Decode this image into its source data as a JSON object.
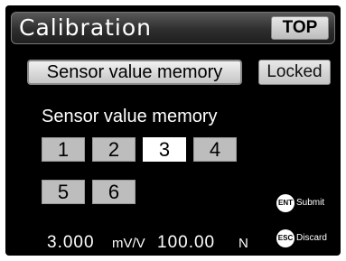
{
  "header": {
    "title": "Calibration",
    "top_button": "TOP"
  },
  "menu": {
    "selected_item": "Sensor value memory",
    "status": "Locked"
  },
  "memory": {
    "label": "Sensor value memory",
    "slots": [
      "1",
      "2",
      "3",
      "4",
      "5",
      "6"
    ],
    "selected": "3"
  },
  "keys": {
    "submit": {
      "key": "ENT",
      "label": "Submit"
    },
    "discard": {
      "key": "ESC",
      "label": "Discard"
    }
  },
  "readout": {
    "sensitivity": "3.000",
    "sensitivity_unit": "mV/V",
    "force": "100.00",
    "force_unit": "N"
  },
  "colors": {
    "screen": "#000000",
    "selected_slot": "#ffffff",
    "slot": "#bdbdbd"
  }
}
